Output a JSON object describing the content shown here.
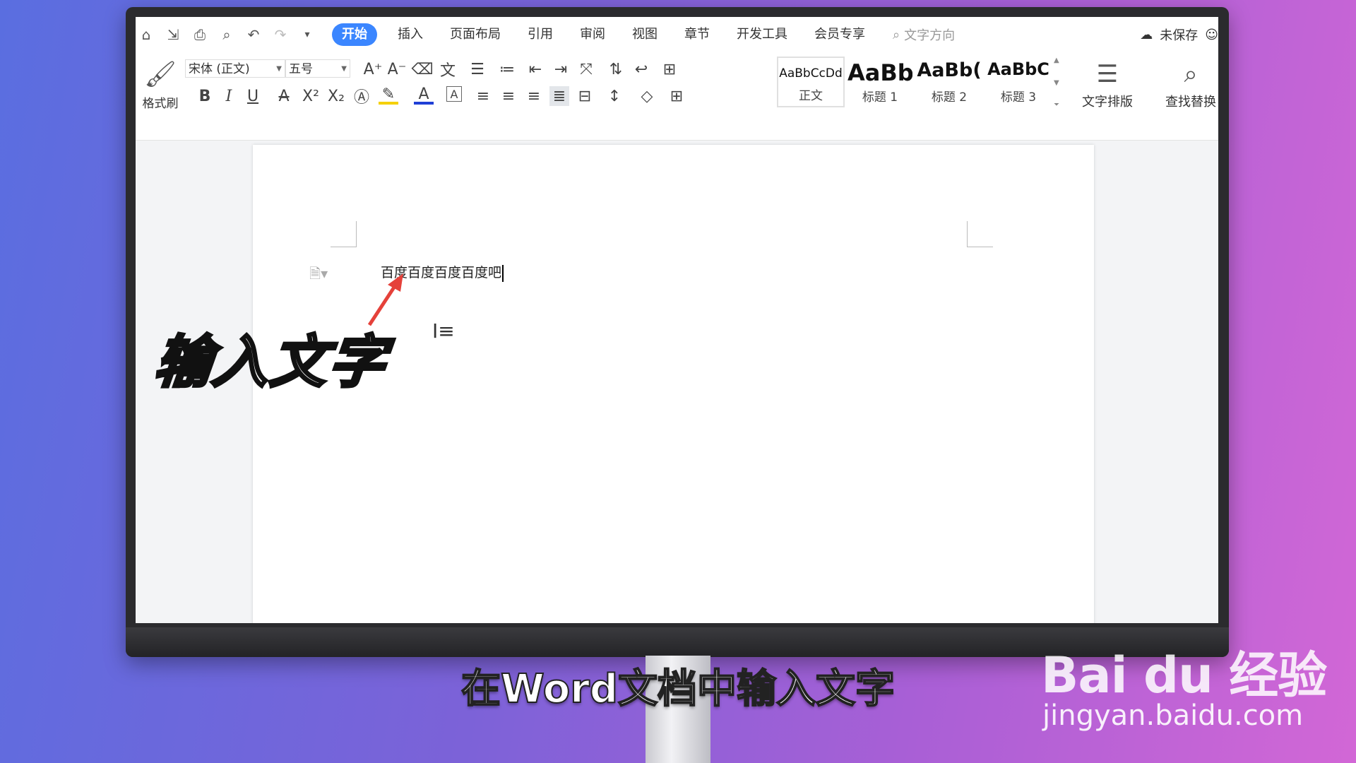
{
  "tabs": {
    "active": "开始",
    "items": [
      "插入",
      "页面布局",
      "引用",
      "审阅",
      "视图",
      "章节",
      "开发工具",
      "会员专享"
    ],
    "search": "文字方向"
  },
  "status": {
    "unsaved": "未保存"
  },
  "ribbon": {
    "format_painter": "格式刷",
    "font_name": "宋体 (正文)",
    "font_size": "五号",
    "styles": [
      {
        "preview": "AaBbCcDd",
        "name": "正文"
      },
      {
        "preview": "AaBb",
        "name": "标题 1"
      },
      {
        "preview": "AaBb(",
        "name": "标题 2"
      },
      {
        "preview": "AaBbC",
        "name": "标题 3"
      }
    ],
    "text_layout": "文字排版",
    "find_replace": "查找替换"
  },
  "document": {
    "text": "百度百度百度百度吧"
  },
  "overlay": {
    "label": "输入文字",
    "caption": "在Word文档中输入文字",
    "watermark_logo": "Bai du 经验",
    "watermark_url": "jingyan.baidu.com"
  },
  "colors": {
    "accent": "#3b86ff",
    "arrow": "#e5413a",
    "highlight": "#f5d000",
    "font_color": "#1f3fd6"
  }
}
